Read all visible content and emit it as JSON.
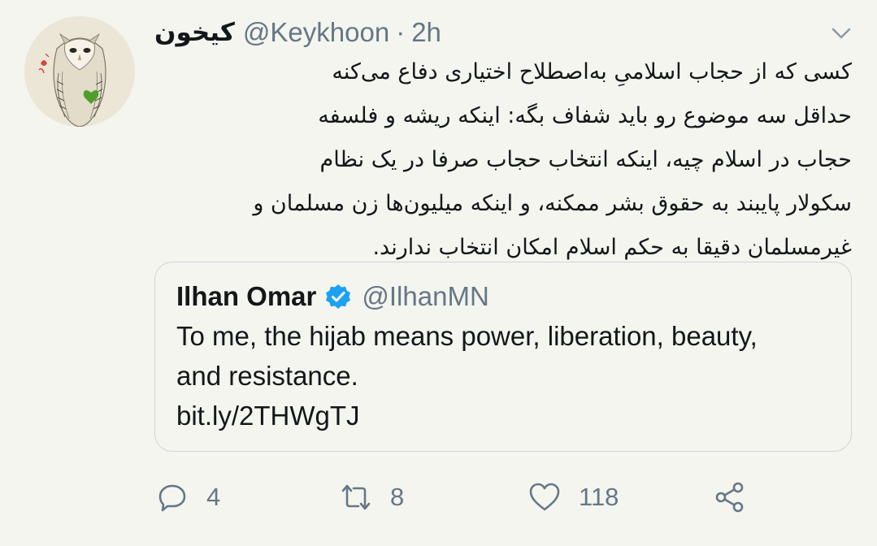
{
  "tweet": {
    "author": {
      "display_name": "کیخون",
      "handle": "@Keykhoon",
      "separator": "·",
      "time": "2h",
      "avatar_icon": "owl-avatar-icon"
    },
    "body_lines": [
      "کسی که از حجاب اسلامیِ به‌اصطلاح اختیاری دفاع می‌کنه",
      "حداقل سه موضوع رو باید شفاف بگه: اینکه ریشه و فلسفه",
      "حجاب در اسلام چیه، اینکه انتخاب حجاب صرفا در یک نظام",
      "سکولار پایبند به حقوق بشر ممکنه، و اینکه میلیون‌ها زن مسلمان و",
      "غیرمسلمان دقیقا به حکم اسلام امکان انتخاب ندارند."
    ],
    "more_icon": "chevron-down-icon"
  },
  "quoted": {
    "display_name": "Ilhan Omar",
    "verified_icon": "verified-badge-icon",
    "handle": "@IlhanMN",
    "lines": [
      "To me, the hijab means power, liberation, beauty,",
      "and resistance.",
      "bit.ly/2THWgTJ"
    ]
  },
  "actions": {
    "reply": {
      "icon": "reply-icon",
      "count": "4"
    },
    "retweet": {
      "icon": "retweet-icon",
      "count": "8"
    },
    "like": {
      "icon": "heart-icon",
      "count": "118"
    },
    "share": {
      "icon": "share-icon"
    }
  },
  "colors": {
    "background": "#f4f5ef",
    "text": "#14171a",
    "muted": "#657786",
    "verified": "#1da1f2",
    "border": "#cfd3d6"
  }
}
